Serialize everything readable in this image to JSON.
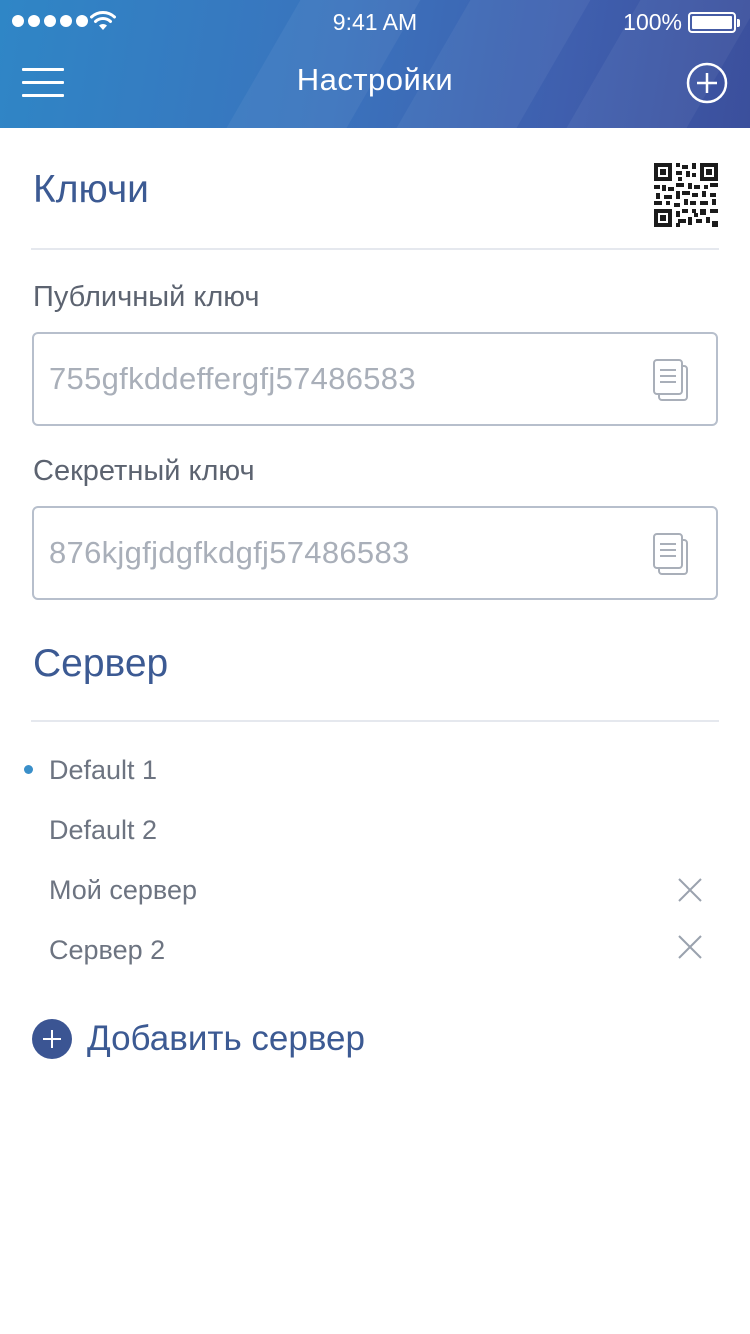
{
  "status_bar": {
    "time": "9:41 AM",
    "battery_percent": "100%",
    "signal_icon": "signal-dots-icon",
    "wifi_icon": "wifi-icon",
    "battery_icon": "battery-icon"
  },
  "nav": {
    "title": "Настройки",
    "menu_icon": "hamburger-menu-icon",
    "add_icon": "plus-circle-icon"
  },
  "keys": {
    "title": "Ключи",
    "qr_icon": "qr-code-icon",
    "public_key": {
      "label": "Публичный ключ",
      "value": "755gfkddeffergfj57486583",
      "copy_icon": "copy-icon"
    },
    "secret_key": {
      "label": "Секретный ключ",
      "value": "876kjgfjdgfkdgfj57486583",
      "copy_icon": "copy-icon"
    }
  },
  "server": {
    "title": "Сервер",
    "items": [
      {
        "label": "Default 1",
        "selected": true,
        "removable": false
      },
      {
        "label": "Default 2",
        "selected": false,
        "removable": false
      },
      {
        "label": "Мой сервер",
        "selected": false,
        "removable": true
      },
      {
        "label": "Сервер 2",
        "selected": false,
        "removable": true
      }
    ],
    "add_label": "Добавить сервер",
    "add_icon": "plus-circle-icon",
    "remove_icon": "close-icon"
  },
  "colors": {
    "accent": "#3c5a93",
    "header_gradient_start": "#2f86c6",
    "header_gradient_end": "#3b4f9c",
    "selected_dot": "#3a8fc9"
  }
}
